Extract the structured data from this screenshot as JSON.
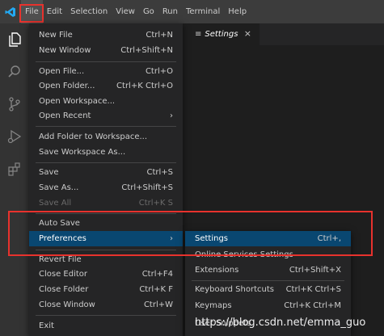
{
  "menubar": {
    "items": [
      "File",
      "Edit",
      "Selection",
      "View",
      "Go",
      "Run",
      "Terminal",
      "Help"
    ],
    "active": "File"
  },
  "activity_bar": {
    "icons": [
      "files-icon",
      "search-icon",
      "source-control-icon",
      "run-debug-icon",
      "extensions-icon"
    ]
  },
  "editor": {
    "tab": {
      "label": "Settings",
      "close": "×",
      "icon": "≡"
    }
  },
  "file_menu": {
    "items": [
      {
        "label": "New File",
        "shortcut": "Ctrl+N"
      },
      {
        "label": "New Window",
        "shortcut": "Ctrl+Shift+N"
      },
      {
        "label": "Open File...",
        "shortcut": "Ctrl+O"
      },
      {
        "label": "Open Folder...",
        "shortcut": "Ctrl+K Ctrl+O"
      },
      {
        "label": "Open Workspace...",
        "shortcut": ""
      },
      {
        "label": "Open Recent",
        "shortcut": "›"
      },
      {
        "label": "Add Folder to Workspace...",
        "shortcut": ""
      },
      {
        "label": "Save Workspace As...",
        "shortcut": ""
      },
      {
        "label": "Save",
        "shortcut": "Ctrl+S"
      },
      {
        "label": "Save As...",
        "shortcut": "Ctrl+Shift+S"
      },
      {
        "label": "Save All",
        "shortcut": "Ctrl+K S"
      },
      {
        "label": "Auto Save",
        "shortcut": ""
      },
      {
        "label": "Preferences",
        "shortcut": "›"
      },
      {
        "label": "Revert File",
        "shortcut": ""
      },
      {
        "label": "Close Editor",
        "shortcut": "Ctrl+F4"
      },
      {
        "label": "Close Folder",
        "shortcut": "Ctrl+K F"
      },
      {
        "label": "Close Window",
        "shortcut": "Ctrl+W"
      },
      {
        "label": "Exit",
        "shortcut": ""
      }
    ]
  },
  "preferences_submenu": {
    "items": [
      {
        "label": "Settings",
        "shortcut": "Ctrl+,"
      },
      {
        "label": "Online Services Settings",
        "shortcut": ""
      },
      {
        "label": "Extensions",
        "shortcut": "Ctrl+Shift+X"
      },
      {
        "label": "Keyboard Shortcuts",
        "shortcut": "Ctrl+K Ctrl+S"
      },
      {
        "label": "Keymaps",
        "shortcut": "Ctrl+K Ctrl+M"
      },
      {
        "label": "User Snippets",
        "shortcut": ""
      }
    ]
  },
  "watermark": "https://blog.csdn.net/emma_guo",
  "colors": {
    "menubar_bg": "#3c3c3c",
    "menu_bg": "#252526",
    "selection_bg": "#094771",
    "highlight_border": "#e8322d",
    "logo_blue": "#23a9f2"
  }
}
